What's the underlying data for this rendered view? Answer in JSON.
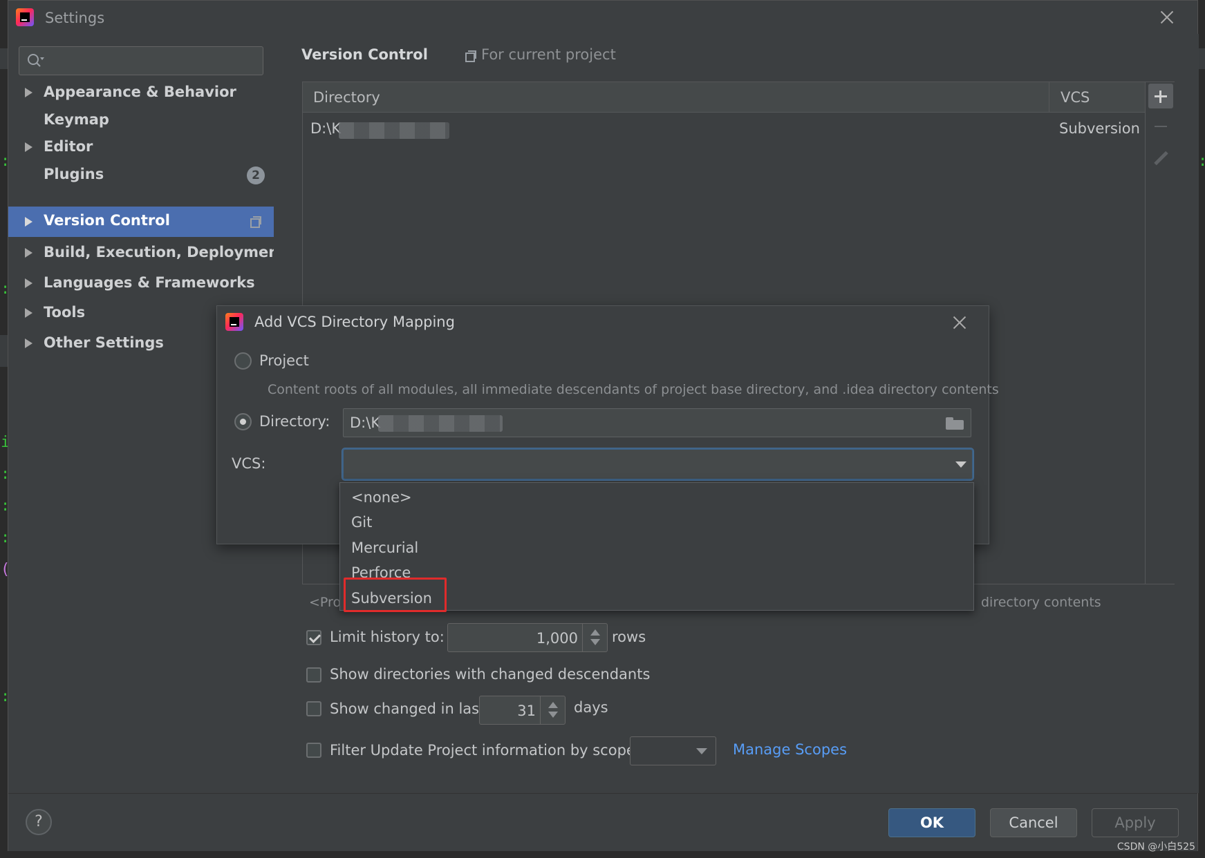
{
  "window": {
    "title": "Settings"
  },
  "sidebar": {
    "search_placeholder": "",
    "items": [
      {
        "label": "Appearance & Behavior",
        "expandable": true
      },
      {
        "label": "Keymap",
        "expandable": false
      },
      {
        "label": "Editor",
        "expandable": true
      },
      {
        "label": "Plugins",
        "expandable": false,
        "badge": "2"
      },
      {
        "label": "Version Control",
        "expandable": true,
        "selected": true
      },
      {
        "label": "Build, Execution, Deployment",
        "expandable": true
      },
      {
        "label": "Languages & Frameworks",
        "expandable": true
      },
      {
        "label": "Tools",
        "expandable": true
      },
      {
        "label": "Other Settings",
        "expandable": true
      }
    ]
  },
  "main": {
    "title": "Version Control",
    "scope_label": "For current project",
    "table": {
      "headers": [
        "Directory",
        "VCS"
      ],
      "rows": [
        {
          "directory": "D:\\K",
          "vcs": "Subversion"
        }
      ]
    },
    "below_table_left": "<Proje",
    "below_table_right": "directory contents",
    "options": {
      "limit_history_label": "Limit history to:",
      "limit_history_value": "1,000",
      "limit_history_unit": "rows",
      "limit_history_checked": true,
      "show_dirs_label": "Show directories with changed descendants",
      "show_changed_label": "Show changed in last",
      "show_changed_value": "31",
      "show_changed_unit": "days",
      "filter_label": "Filter Update Project information by scope",
      "manage_scopes": "Manage Scopes"
    }
  },
  "footer": {
    "help": "?",
    "ok": "OK",
    "cancel": "Cancel",
    "apply": "Apply"
  },
  "dialog": {
    "title": "Add VCS Directory Mapping",
    "project_label": "Project",
    "project_hint": "Content roots of all modules, all immediate descendants of project base directory, and .idea directory contents",
    "directory_label": "Directory:",
    "directory_value": "D:\\K",
    "vcs_label": "VCS:",
    "vcs_value": ""
  },
  "dropdown": {
    "options": [
      "<none>",
      "Git",
      "Mercurial",
      "Perforce",
      "Subversion"
    ],
    "highlighted": "Subversion"
  },
  "watermark": "CSDN @小白525",
  "colors": {
    "accent_selection": "#4b6eaf",
    "primary_button": "#365880",
    "link": "#589df6",
    "highlight_box": "#e02b2b"
  }
}
